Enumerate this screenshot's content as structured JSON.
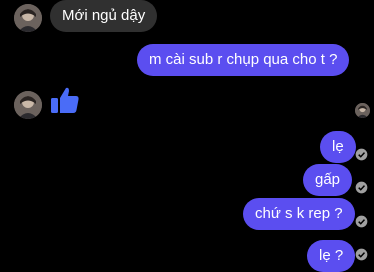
{
  "colors": {
    "background": "#000000",
    "incoming_bubble": "#303030",
    "outgoing_bubble": "#5b4ef0",
    "like_icon": "#4a6cf7",
    "check_icon": "#a0a0a0"
  },
  "messages": [
    {
      "direction": "incoming",
      "text": "Mới ngủ dậy"
    },
    {
      "direction": "outgoing",
      "text": "m cài sub r chụp qua cho t ?"
    },
    {
      "direction": "incoming",
      "icon": "thumbs-up-icon"
    },
    {
      "direction": "outgoing",
      "text": "lẹ"
    },
    {
      "direction": "outgoing",
      "text": "gấp"
    },
    {
      "direction": "outgoing",
      "text": "chứ s k rep ?"
    },
    {
      "direction": "outgoing",
      "text": "lẹ ?"
    }
  ]
}
